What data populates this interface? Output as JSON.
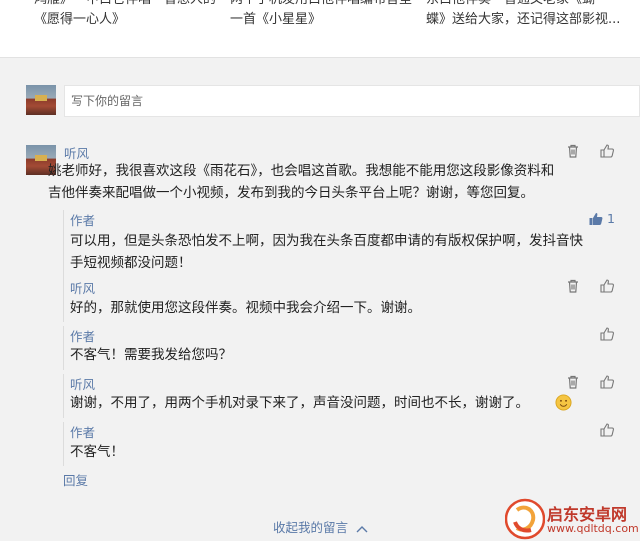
{
  "related_articles": [
    {
      "line1": "鸿雁》—甲白它伴唱一曾想人的",
      "line2": "《愿得一心人》"
    },
    {
      "line1": "两个手机发用白他伴唱编布音室",
      "line2": "一首《小星星》"
    },
    {
      "line1": "东白他伴奏一普通文老家《蝴",
      "line2": "蝶》送给大家，还记得这部影视..."
    }
  ],
  "compose": {
    "placeholder": "写下你的留言"
  },
  "comment": {
    "author": "听风",
    "text_lines": [
      "姚老师好，我很喜欢这段《雨花石》，也会唱这首歌。我想能不能用您这段影像资料和",
      "吉他伴奏来配唱做一个小视频，发布到我的今日头条平台上呢？谢谢，等您回复。"
    ]
  },
  "replies": [
    {
      "author": "作者",
      "lines": [
        "可以用，但是头条恐怕发不上啊，因为我在头条百度都申请的有版权保护啊，发抖音快",
        "手短视频都没问题！"
      ],
      "likes": "1"
    },
    {
      "author": "听风",
      "lines": [
        "好的，那就使用您这段伴奏。视频中我会介绍一下。谢谢。"
      ]
    },
    {
      "author": "作者",
      "lines": [
        "不客气！需要我发给您吗？"
      ]
    },
    {
      "author": "听风",
      "lines": [
        "谢谢，不用了，用两个手机对录下来了，声音没问题，时间也不长，谢谢了。"
      ]
    },
    {
      "author": "作者",
      "lines": [
        "不客气！"
      ]
    }
  ],
  "reply_link": "回复",
  "collapse_link": "收起我的留言",
  "watermark": {
    "title": "启东安卓网",
    "url": "www.qdltdq.com"
  },
  "colors": {
    "link": "#5b7aa8",
    "accent_red": "#d63b2b"
  }
}
